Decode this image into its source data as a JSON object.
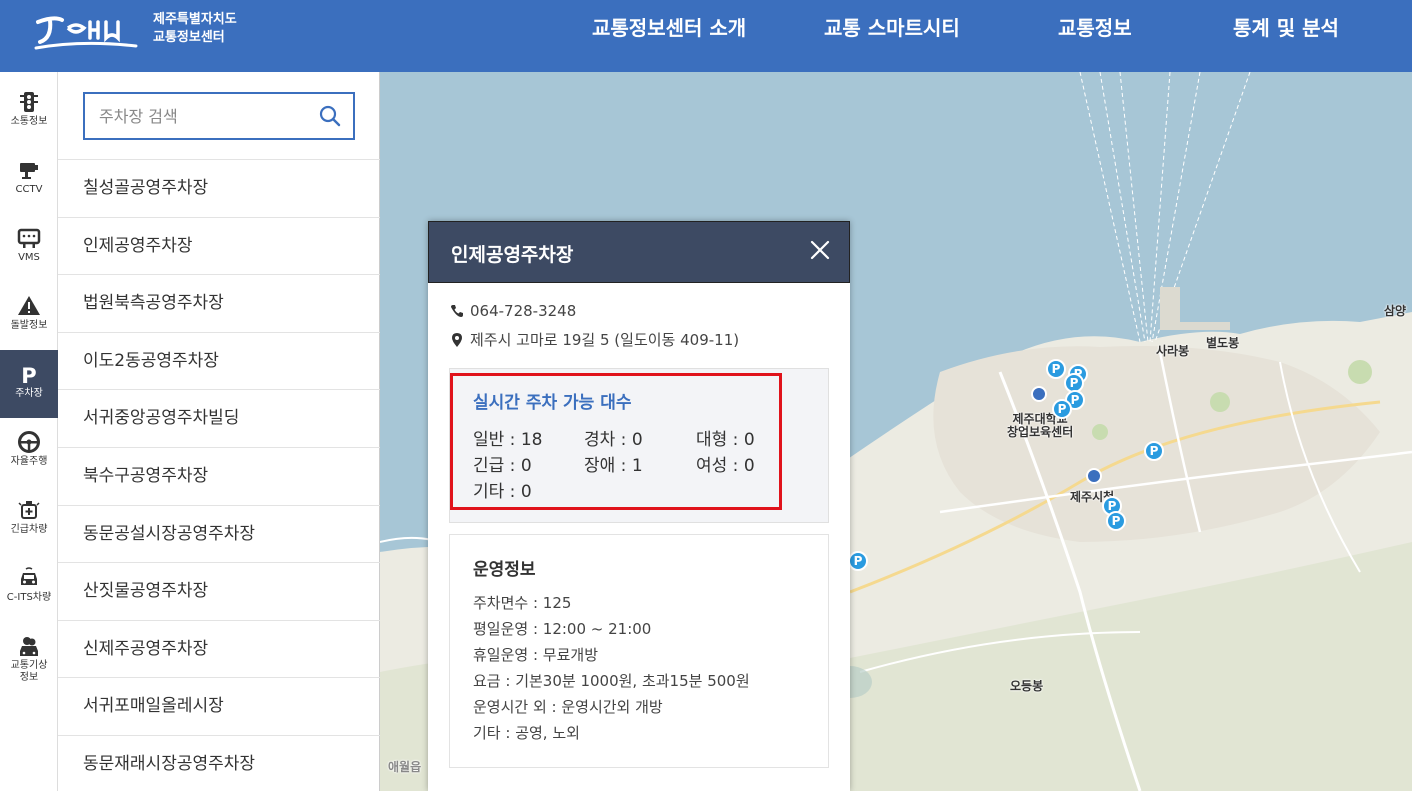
{
  "header": {
    "org_line1": "제주특별자치도",
    "org_line2": "교통정보센터",
    "nav": [
      "교통정보센터 소개",
      "교통 스마트시티",
      "교통정보",
      "통계 및 분석"
    ],
    "bg_color": "#3b6fbe"
  },
  "rail": [
    {
      "label": "소통정보",
      "icon": "traffic-light-icon"
    },
    {
      "label": "CCTV",
      "icon": "cctv-camera-icon"
    },
    {
      "label": "VMS",
      "icon": "vms-sign-icon"
    },
    {
      "label": "돌발정보",
      "icon": "warning-icon"
    },
    {
      "label": "주차장",
      "icon": "parking-icon",
      "active": true
    },
    {
      "label": "자율주행",
      "icon": "steering-wheel-icon"
    },
    {
      "label": "긴급차량",
      "icon": "emergency-vehicle-icon"
    },
    {
      "label": "C-ITS차량",
      "icon": "car-icon"
    },
    {
      "label": "교통기상\n정보",
      "icon": "weather-car-icon"
    }
  ],
  "search": {
    "placeholder": "주차장 검색"
  },
  "parking_list": [
    "칠성골공영주차장",
    "인제공영주차장",
    "법원북측공영주차장",
    "이도2동공영주차장",
    "서귀중앙공영주차빌딩",
    "북수구공영주차장",
    "동문공설시장공영주차장",
    "산짓물공영주차장",
    "신제주공영주차장",
    "서귀포매일올레시장",
    "동문재래시장공영주차장"
  ],
  "popup": {
    "title": "인제공영주차장",
    "phone": "064-728-3248",
    "address": "제주시 고마로 19길 5 (일도이동 409-11)",
    "realtime_title": "실시간 주차 가능 대수",
    "realtime": [
      "일반 : 18",
      "경차 : 0",
      "대형 : 0",
      "긴급 : 0",
      "장애 : 1",
      "여성 : 0",
      "기타 : 0"
    ],
    "op_title": "운영정보",
    "op_lines": [
      "주차면수 : 125",
      "평일운영 : 12:00 ~ 21:00",
      "휴일운영 : 무료개방",
      "요금 : 기본30분 1000원, 초과15분 500원",
      "운영시간 외 : 운영시간외 개방",
      "기타 : 공영, 노외"
    ]
  },
  "map": {
    "labels": [
      "사라봉",
      "별도봉",
      "제주대학교\n창업보육센터",
      "제주시청",
      "오등봉",
      "삼양",
      "애월읍"
    ],
    "marker_glyph": "P",
    "sea_color": "#a7c6d6",
    "land_color": "#ecebe2",
    "marker_color": "#2a9be0"
  }
}
